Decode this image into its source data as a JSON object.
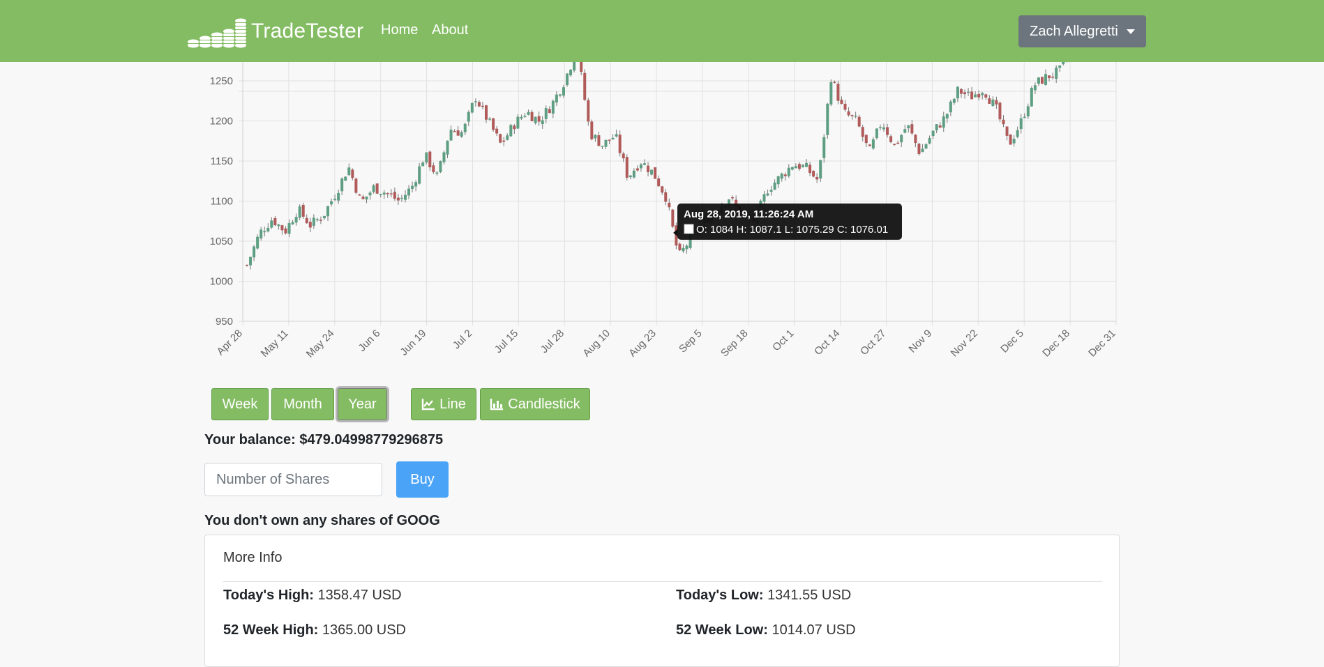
{
  "app": {
    "brand": "TradeTester",
    "nav": {
      "home": "Home",
      "about": "About"
    },
    "user": "Zach Allegretti",
    "colors": {
      "navbar": "#84bc63",
      "up": "#5e9e82",
      "down": "#b05a5a",
      "buy": "#4aa3f7"
    }
  },
  "chart_data": {
    "type": "candlestick",
    "ticker": "GOOG",
    "ylim": [
      950,
      1290
    ],
    "yticks": [
      950,
      1000,
      1050,
      1100,
      1150,
      1200,
      1250
    ],
    "xticks": [
      "Apr 28",
      "May 11",
      "May 24",
      "Jun 6",
      "Jun 19",
      "Jul 2",
      "Jul 15",
      "Jul 28",
      "Aug 10",
      "Aug 23",
      "Sep 5",
      "Sep 18",
      "Oct 1",
      "Oct 14",
      "Oct 27",
      "Nov 9",
      "Nov 22",
      "Dec 5",
      "Dec 18",
      "Dec 31"
    ],
    "grid": true,
    "trend_closes": [
      [
        0,
        1020
      ],
      [
        1,
        1060
      ],
      [
        2,
        1078
      ],
      [
        3,
        1062
      ],
      [
        4,
        1090
      ],
      [
        5,
        1070
      ],
      [
        6,
        1082
      ],
      [
        7,
        1110
      ],
      [
        8,
        1143
      ],
      [
        9,
        1098
      ],
      [
        10,
        1117
      ],
      [
        11,
        1110
      ],
      [
        12,
        1100
      ],
      [
        13,
        1118
      ],
      [
        14,
        1158
      ],
      [
        15,
        1130
      ],
      [
        16,
        1190
      ],
      [
        17,
        1185
      ],
      [
        18,
        1230
      ],
      [
        19,
        1200
      ],
      [
        20,
        1170
      ],
      [
        21,
        1195
      ],
      [
        22,
        1212
      ],
      [
        23,
        1200
      ],
      [
        24,
        1220
      ],
      [
        25,
        1250
      ],
      [
        26,
        1290
      ],
      [
        27,
        1185
      ],
      [
        28,
        1170
      ],
      [
        29,
        1182
      ],
      [
        30,
        1130
      ],
      [
        31,
        1150
      ],
      [
        32,
        1135
      ],
      [
        33,
        1105
      ],
      [
        34,
        1030
      ],
      [
        35,
        1055
      ],
      [
        36,
        1075
      ],
      [
        37,
        1090
      ],
      [
        38,
        1105
      ],
      [
        39,
        1080
      ],
      [
        40,
        1076
      ],
      [
        41,
        1115
      ],
      [
        42,
        1130
      ],
      [
        43,
        1146
      ],
      [
        44,
        1142
      ],
      [
        45,
        1125
      ],
      [
        46,
        1255
      ],
      [
        47,
        1210
      ],
      [
        48,
        1200
      ],
      [
        49,
        1160
      ],
      [
        50,
        1200
      ],
      [
        51,
        1168
      ],
      [
        52,
        1195
      ],
      [
        53,
        1160
      ],
      [
        54,
        1185
      ],
      [
        55,
        1205
      ],
      [
        56,
        1238
      ],
      [
        57,
        1230
      ],
      [
        58,
        1240
      ],
      [
        59,
        1215
      ],
      [
        60,
        1170
      ],
      [
        61,
        1200
      ],
      [
        62,
        1245
      ],
      [
        63,
        1255
      ],
      [
        64,
        1262
      ],
      [
        65,
        1300
      ],
      [
        66,
        1300
      ],
      [
        67,
        1290
      ],
      [
        68,
        1280
      ],
      [
        69,
        1290
      ]
    ],
    "tooltip": {
      "title": "Aug 28, 2019, 11:26:24 AM",
      "body": "O: 1084  H: 1087.1  L: 1075.29  C: 1076.01",
      "open": 1084,
      "high": 1087.1,
      "low": 1075.29,
      "close": 1076.01
    }
  },
  "controls": {
    "ranges": [
      "Week",
      "Month",
      "Year"
    ],
    "active_range": "Year",
    "line_label": "Line",
    "candlestick_label": "Candlestick"
  },
  "trade": {
    "balance_label": "Your balance: $479.04998779296875",
    "shares_placeholder": "Number of Shares",
    "buy_label": "Buy",
    "ownership": "You don't own any shares of GOOG"
  },
  "info": {
    "title": "More Info",
    "todays_high_label": "Today's High:",
    "todays_high_value": "1358.47 USD",
    "todays_low_label": "Today's Low:",
    "todays_low_value": "1341.55 USD",
    "week52_high_label": "52 Week High:",
    "week52_high_value": "1365.00 USD",
    "week52_low_label": "52 Week Low:",
    "week52_low_value": "1014.07 USD"
  }
}
